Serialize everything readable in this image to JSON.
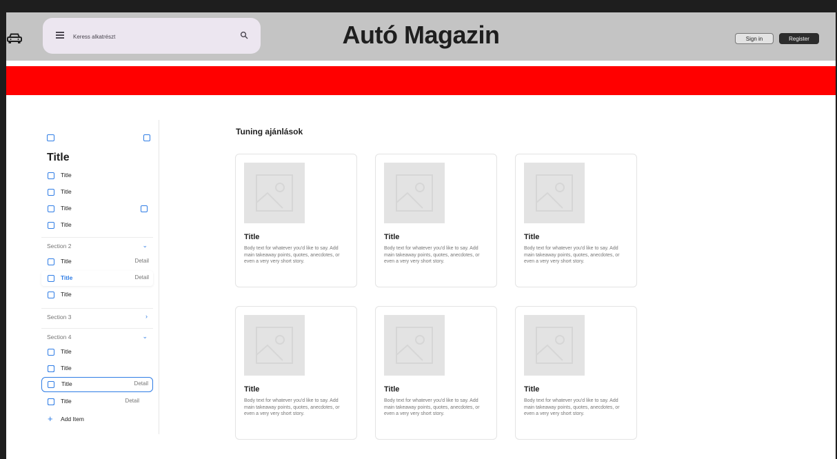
{
  "header": {
    "search_placeholder": "Keress alkatrészt",
    "site_title": "Autó Magazin",
    "signin_label": "Sign in",
    "register_label": "Register"
  },
  "sidebar": {
    "title": "Title",
    "group1": [
      {
        "label": "Title"
      },
      {
        "label": "Title"
      },
      {
        "label": "Title"
      },
      {
        "label": "Title"
      }
    ],
    "section2": {
      "label": "Section 2",
      "items": [
        {
          "label": "Title",
          "detail": "Detail"
        },
        {
          "label": "Title",
          "detail": "Detail"
        },
        {
          "label": "Title"
        }
      ]
    },
    "section3": {
      "label": "Section 3"
    },
    "section4": {
      "label": "Section 4",
      "items": [
        {
          "label": "Title"
        },
        {
          "label": "Title"
        },
        {
          "label": "Title",
          "detail": "Detail"
        },
        {
          "label": "Title",
          "detail": "Detail"
        }
      ]
    },
    "add_item_label": "Add Item"
  },
  "main": {
    "section_title": "Tuning ajánlások",
    "cards": [
      {
        "title": "Title",
        "body": "Body text for whatever you'd like to say. Add main takeaway points, quotes, anecdotes, or even a very very short story."
      },
      {
        "title": "Title",
        "body": "Body text for whatever you'd like to say. Add main takeaway points, quotes, anecdotes, or even a very very short story."
      },
      {
        "title": "Title",
        "body": "Body text for whatever you'd like to say. Add main takeaway points, quotes, anecdotes, or even a very very short story."
      },
      {
        "title": "Title",
        "body": "Body text for whatever you'd like to say. Add main takeaway points, quotes, anecdotes, or even a very very short story."
      },
      {
        "title": "Title",
        "body": "Body text for whatever you'd like to say. Add main takeaway points, quotes, anecdotes, or even a very very short story."
      },
      {
        "title": "Title",
        "body": "Body text for whatever you'd like to say. Add main takeaway points, quotes, anecdotes, or even a very very short story."
      }
    ]
  },
  "colors": {
    "header_bg": "#c4c4c4",
    "banner_red": "#ff0000",
    "accent_blue": "#2c7be5",
    "search_bg": "#ece6f0"
  },
  "icons": {
    "brand": "car-icon",
    "menu": "menu-icon",
    "search": "search-icon",
    "placeholder": "image-placeholder-icon",
    "list_item": "square-icon",
    "add": "plus-icon"
  }
}
